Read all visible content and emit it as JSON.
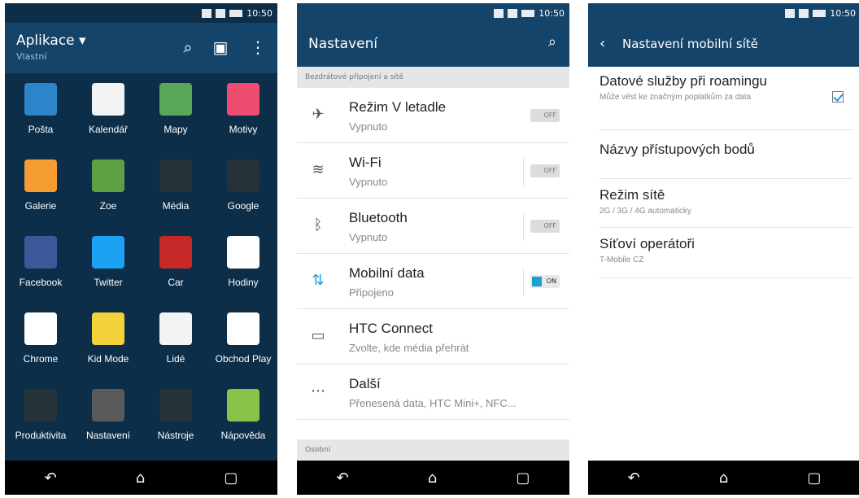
{
  "status_time": "10:50",
  "screen1": {
    "header_title": "Aplikace ▾",
    "header_subtitle": "Vlastní",
    "apps": [
      {
        "label": "Pošta",
        "color": "#2c84c9"
      },
      {
        "label": "Kalendář",
        "color": "#f3f3f3"
      },
      {
        "label": "Mapy",
        "color": "#58a75a"
      },
      {
        "label": "Motivy",
        "color": "#ef4c71"
      },
      {
        "label": "Galerie",
        "color": "#f59d32"
      },
      {
        "label": "Zoe",
        "color": "#5ea145"
      },
      {
        "label": "Média",
        "color": "#263238"
      },
      {
        "label": "Google",
        "color": "#263238"
      },
      {
        "label": "Facebook",
        "color": "#3b5998"
      },
      {
        "label": "Twitter",
        "color": "#1da1f2"
      },
      {
        "label": "Car",
        "color": "#c62828"
      },
      {
        "label": "Hodiny",
        "color": "#ffffff"
      },
      {
        "label": "Chrome",
        "color": "#ffffff"
      },
      {
        "label": "Kid Mode",
        "color": "#f2d13a"
      },
      {
        "label": "Lidé",
        "color": "#f3f3f3"
      },
      {
        "label": "Obchod Play",
        "color": "#ffffff"
      },
      {
        "label": "Produktivita",
        "color": "#263238"
      },
      {
        "label": "Nastavení",
        "color": "#5a5a5a"
      },
      {
        "label": "Nástroje",
        "color": "#263238"
      },
      {
        "label": "Nápověda",
        "color": "#8bc34a"
      }
    ]
  },
  "screen2": {
    "title": "Nastavení",
    "section_wireless": "Bezdrátové připojení a sítě",
    "rows": [
      {
        "name": "Režim V letadle",
        "sub": "Vypnuto",
        "toggle": "OFF",
        "icon": "airplane-icon"
      },
      {
        "name": "Wi-Fi",
        "sub": "Vypnuto",
        "toggle": "OFF",
        "icon": "wifi-icon"
      },
      {
        "name": "Bluetooth",
        "sub": "Vypnuto",
        "toggle": "OFF",
        "icon": "bluetooth-icon"
      },
      {
        "name": "Mobilní data",
        "sub": "Připojeno",
        "toggle": "ON",
        "icon": "mobile-data-icon"
      },
      {
        "name": "HTC Connect",
        "sub": "Zvolte, kde média přehrát",
        "toggle": "",
        "icon": "htc-connect-icon"
      },
      {
        "name": "Další",
        "sub": "Přenesená data, HTC Mini+, NFC...",
        "toggle": "",
        "icon": "more-icon"
      }
    ],
    "section_personal": "Osobní"
  },
  "screen3": {
    "title": "Nastavení mobilní sítě",
    "rows": [
      {
        "name": "Datové služby při roamingu",
        "sub": "Může vést ke značným poplatkům za data",
        "checked": true
      },
      {
        "name": "Názvy přístupových bodů",
        "sub": ""
      },
      {
        "name": "Režim sítě",
        "sub": "2G / 3G / 4G automaticky"
      },
      {
        "name": "Síťoví operátoři",
        "sub": "T-Mobile CZ"
      }
    ]
  }
}
